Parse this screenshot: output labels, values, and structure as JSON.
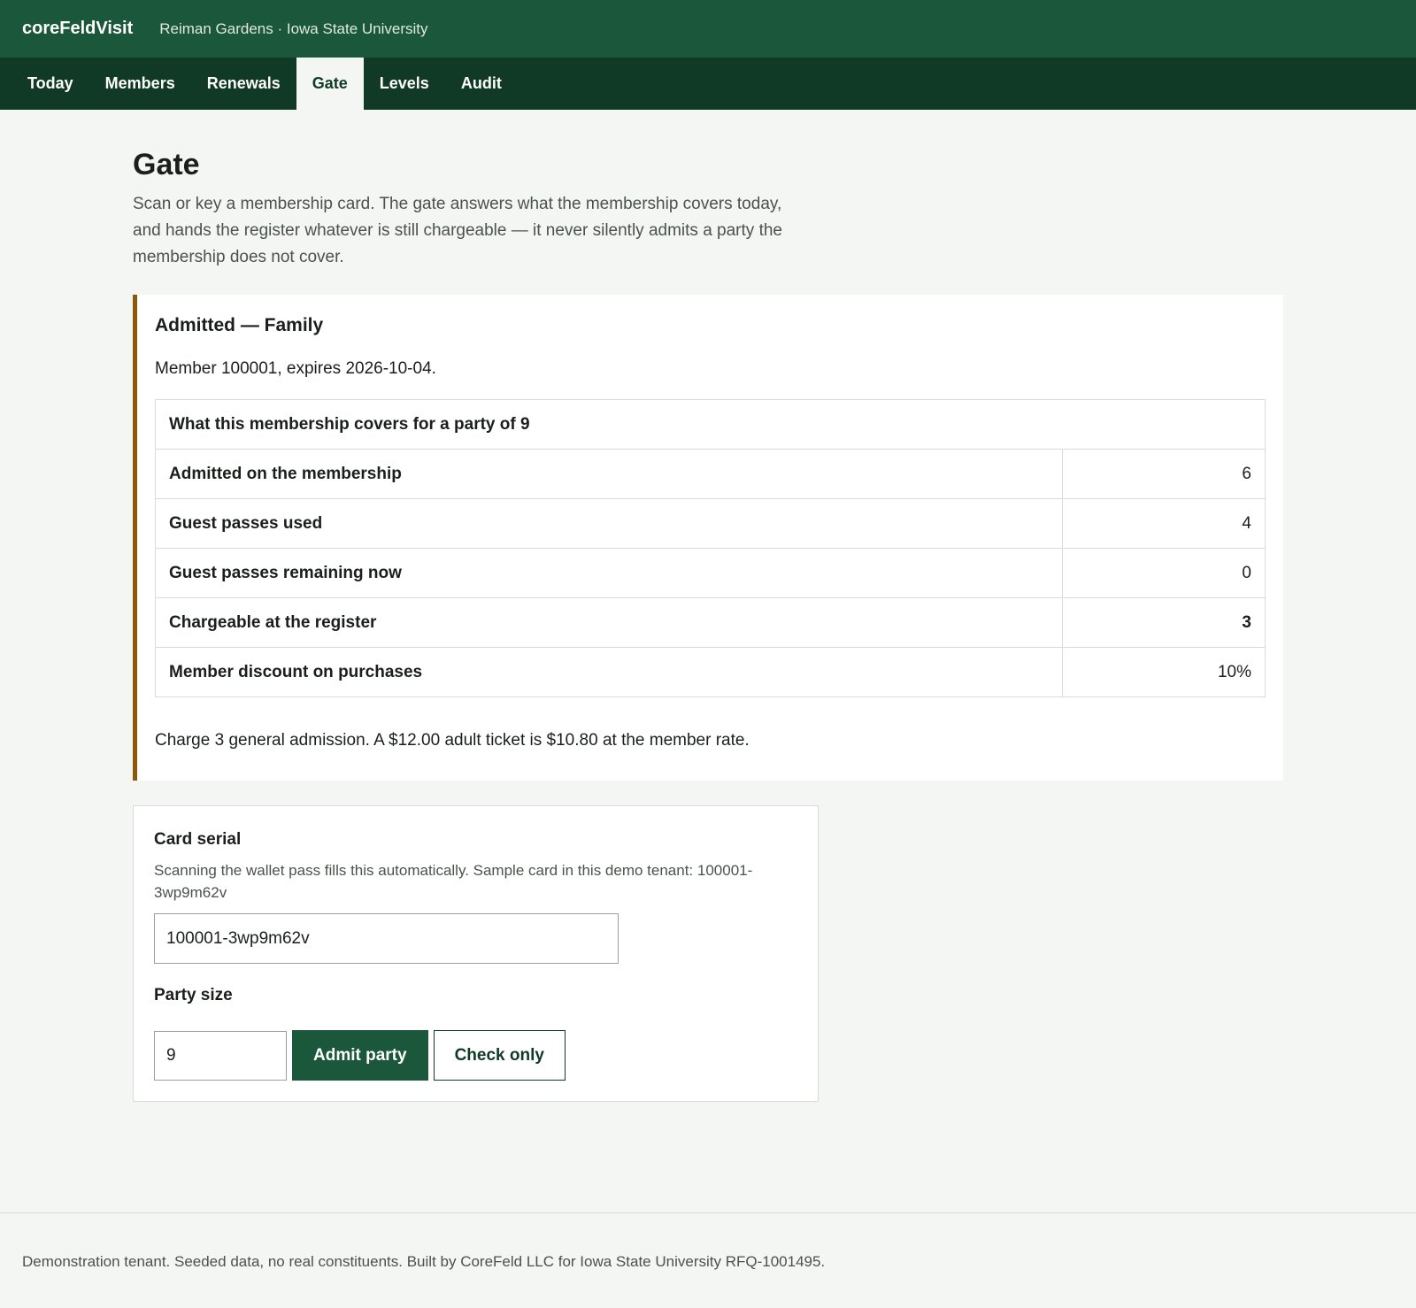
{
  "header": {
    "brand": "coreFeldVisit",
    "org": "Reiman Gardens · Iowa State University"
  },
  "nav": {
    "tabs": [
      "Today",
      "Members",
      "Renewals",
      "Gate",
      "Levels",
      "Audit"
    ],
    "active": "Gate"
  },
  "page": {
    "title": "Gate",
    "intro": "Scan or key a membership card. The gate answers what the membership covers today, and hands the register whatever is still chargeable — it never silently admits a party the membership does not cover."
  },
  "result": {
    "heading": "Admitted — Family",
    "member_line": "Member 100001, expires 2026-10-04.",
    "table_title": "What this membership covers for a party of 9",
    "rows": [
      {
        "label": "Admitted on the membership",
        "value": "6"
      },
      {
        "label": "Guest passes used",
        "value": "4"
      },
      {
        "label": "Guest passes remaining now",
        "value": "0"
      },
      {
        "label": "Chargeable at the register",
        "value": "3"
      },
      {
        "label": "Member discount on purchases",
        "value": "10%"
      }
    ],
    "note": "Charge 3 general admission. A $12.00 adult ticket is $10.80 at the member rate.",
    "accent_color": "#8a5a08"
  },
  "form": {
    "serial_label": "Card serial",
    "serial_help": "Scanning the wallet pass fills this automatically. Sample card in this demo tenant: 100001-3wp9m62v",
    "serial_value": "100001-3wp9m62v",
    "party_label": "Party size",
    "party_value": "9",
    "admit_label": "Admit party",
    "check_label": "Check only"
  },
  "footer": {
    "text": "Demonstration tenant. Seeded data, no real constituents. Built by CoreFeld LLC for Iowa State University RFQ-1001495."
  },
  "colors": {
    "header_green": "#1a573b",
    "nav_green": "#103a26",
    "background": "#f4f6f3"
  }
}
